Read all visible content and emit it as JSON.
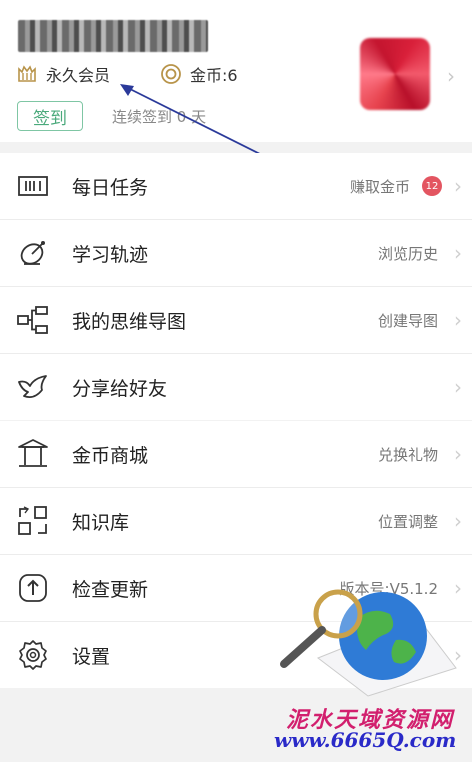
{
  "profile": {
    "username": "",
    "member_label": "永久会员",
    "coin_label": "金币:6",
    "checkin_button": "签到",
    "checkin_text": "连续签到 0 天"
  },
  "section1": [
    {
      "label": "每日任务",
      "right": "赚取金币",
      "badge": "12",
      "icon": "task-barcode-icon"
    },
    {
      "label": "学习轨迹",
      "right": "浏览历史",
      "icon": "satellite-dish-icon"
    },
    {
      "label": "我的思维导图",
      "right": "创建导图",
      "icon": "mindmap-icon"
    },
    {
      "label": "分享给好友",
      "right": "",
      "icon": "share-bird-icon"
    }
  ],
  "section2": [
    {
      "label": "金币商城",
      "right": "兑换礼物",
      "icon": "store-pavilion-icon"
    },
    {
      "label": "知识库",
      "right": "位置调整",
      "icon": "knowledge-grid-icon"
    },
    {
      "label": "检查更新",
      "right": "版本号:V5.1.2",
      "icon": "update-arrow-icon"
    },
    {
      "label": "设置",
      "right": "",
      "icon": "gear-icon"
    }
  ],
  "watermark": {
    "line1": "泥水天域资源网",
    "line2": "www.6665Q.com"
  },
  "colors": {
    "accent_green": "#4aa97b",
    "badge_red": "#e35561",
    "annotation_blue": "#2b3a9a"
  }
}
